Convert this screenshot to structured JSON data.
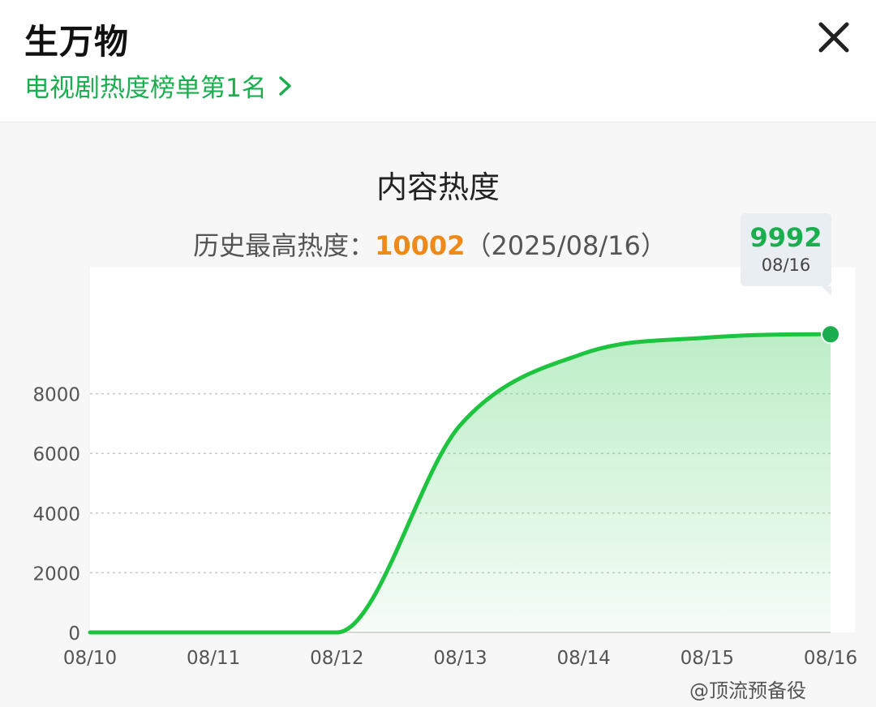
{
  "header": {
    "title": "生万物",
    "rank_link": "电视剧热度榜单第1名"
  },
  "chart_section": {
    "title": "内容热度",
    "peak_label": "历史最高热度：",
    "peak_value": "10002",
    "peak_date": "（2025/08/16）",
    "tooltip": {
      "value": "9992",
      "date": "08/16"
    }
  },
  "watermark": "@顶流预备役",
  "colors": {
    "accent": "#1aae4f",
    "line": "#1ec43f",
    "peak": "#ef8a1a"
  },
  "chart_data": {
    "type": "area",
    "x": [
      "08/10",
      "08/11",
      "08/12",
      "08/13",
      "08/14",
      "08/15",
      "08/16"
    ],
    "y_ticks": [
      0,
      2000,
      4000,
      6000,
      8000
    ],
    "ylim": [
      0,
      10000
    ],
    "grid": true,
    "series": [
      {
        "values": [
          0,
          0,
          0,
          6950,
          9350,
          9880,
          9992
        ]
      }
    ],
    "highlight_point": {
      "x": "08/16",
      "y": 9992
    }
  }
}
